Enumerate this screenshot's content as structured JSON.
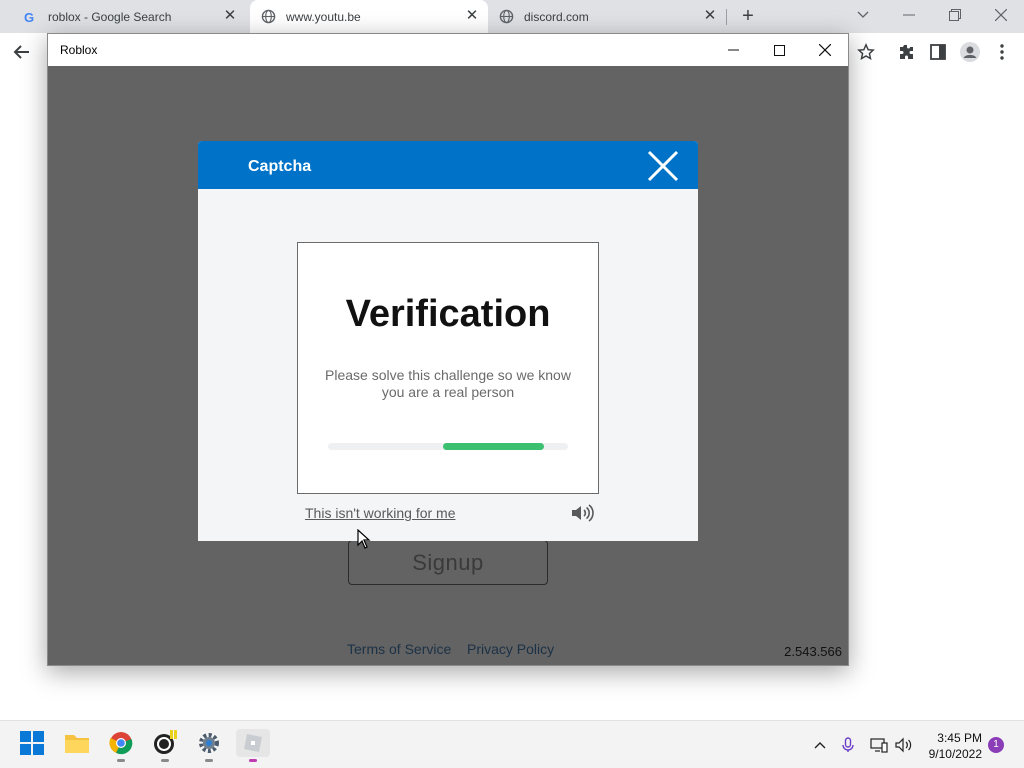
{
  "browser": {
    "tabs": [
      {
        "title": "roblox - Google Search",
        "icon": "google-icon"
      },
      {
        "title": "www.youtu.be",
        "icon": "globe-icon",
        "active": true
      },
      {
        "title": "discord.com",
        "icon": "globe-icon"
      }
    ]
  },
  "window": {
    "title": "Roblox"
  },
  "captcha": {
    "title": "Captcha",
    "verify_title": "Verification",
    "verify_text": "Please solve this challenge so we know you are a real person",
    "progress": {
      "start": 0.48,
      "end": 0.9
    },
    "not_working": "This isn't working for me",
    "header_color": "#0073c8",
    "progress_color": "#3bc070"
  },
  "page": {
    "signup_label": "Signup",
    "terms_label": "Terms of Service",
    "privacy_label": "Privacy Policy",
    "version": "2.543.566"
  },
  "taskbar": {
    "time": "3:45 PM",
    "date": "9/10/2022",
    "notifications": "1"
  }
}
